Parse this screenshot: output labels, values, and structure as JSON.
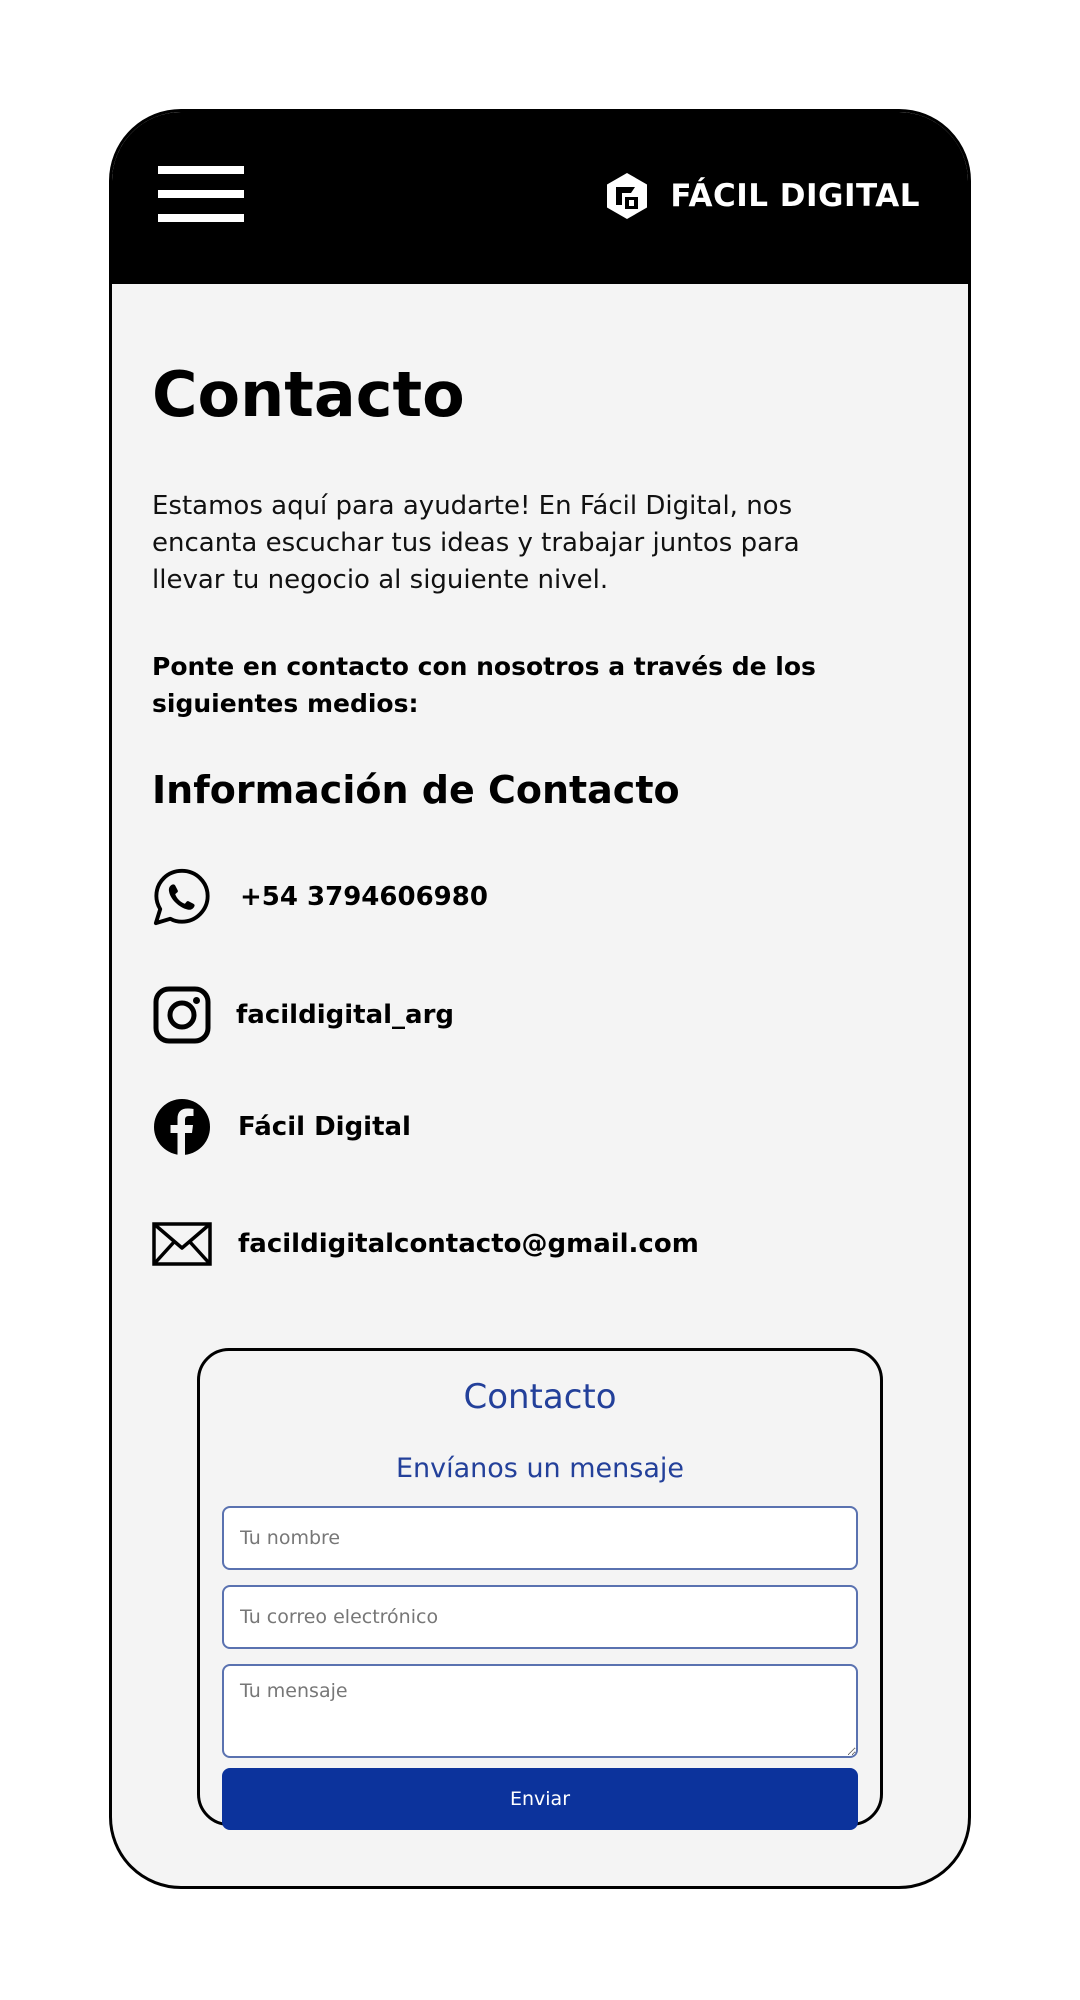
{
  "header": {
    "brand_name": "FÁCIL DIGITAL",
    "menu_icon": "hamburger-menu-icon",
    "logo_icon": "facil-digital-logo"
  },
  "main": {
    "title": "Contacto",
    "intro": "Estamos aquí para ayudarte! En Fácil Digital, nos encanta escuchar tus ideas y trabajar juntos para llevar tu negocio al siguiente nivel.",
    "reach_out": "Ponte en contacto con nosotros a través de los siguientes medios:",
    "info_heading": "Información de Contacto",
    "contacts": [
      {
        "icon": "whatsapp-icon",
        "label": "+54 3794606980"
      },
      {
        "icon": "instagram-icon",
        "label": "facildigital_arg"
      },
      {
        "icon": "facebook-icon",
        "label": "Fácil Digital"
      },
      {
        "icon": "mail-icon",
        "label": "facildigitalcontacto@gmail.com"
      }
    ]
  },
  "form": {
    "title": "Contacto",
    "subtitle": "Envíanos un mensaje",
    "name_placeholder": "Tu nombre",
    "email_placeholder": "Tu correo electrónico",
    "message_placeholder": "Tu mensaje",
    "submit_label": "Enviar"
  },
  "colors": {
    "header_bg": "#000000",
    "page_bg": "#f4f4f4",
    "form_accent": "#23409a",
    "button_bg": "#0c339c"
  }
}
